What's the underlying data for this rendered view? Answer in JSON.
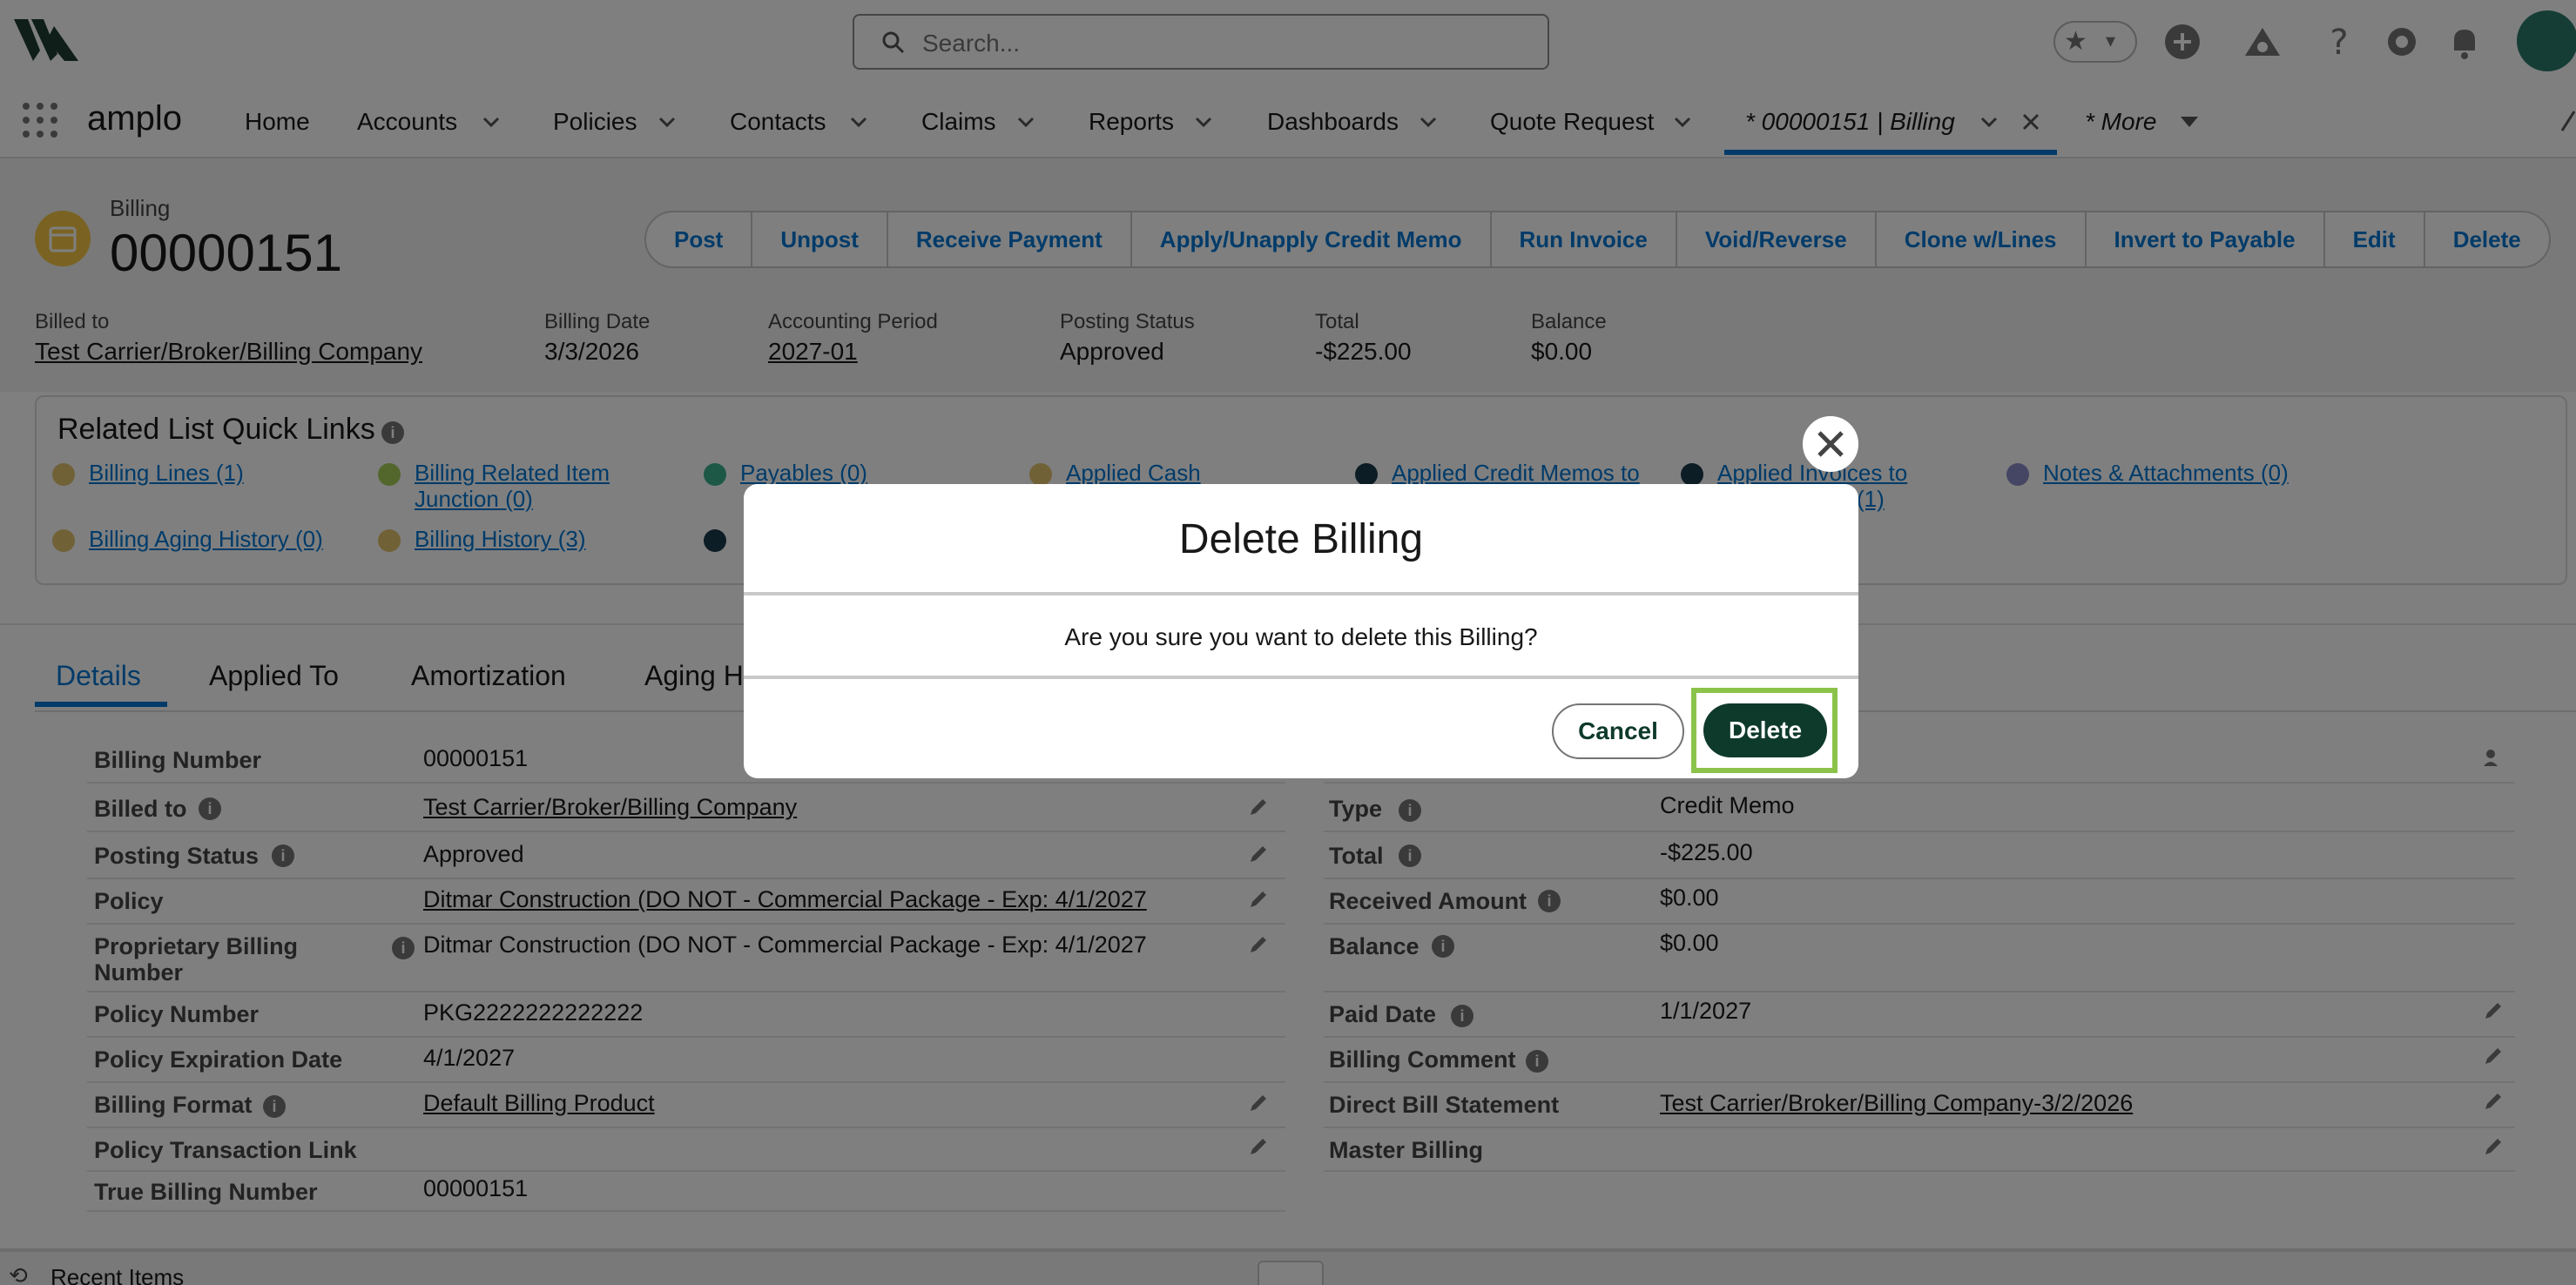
{
  "header": {
    "search_placeholder": "Search..."
  },
  "nav": {
    "app_name": "amplo",
    "items": [
      "Home",
      "Accounts",
      "Policies",
      "Contacts",
      "Claims",
      "Reports",
      "Dashboards",
      "Quote Request"
    ],
    "active_tab": "* 00000151 | Billing",
    "more": "* More"
  },
  "record": {
    "object_label": "Billing",
    "title": "00000151",
    "actions": [
      "Post",
      "Unpost",
      "Receive Payment",
      "Apply/Unapply Credit Memo",
      "Run Invoice",
      "Void/Reverse",
      "Clone w/Lines",
      "Invert to Payable",
      "Edit",
      "Delete"
    ],
    "fields": [
      {
        "label": "Billed to",
        "value": "Test Carrier/Broker/Billing Company"
      },
      {
        "label": "Billing Date",
        "value": "3/3/2026"
      },
      {
        "label": "Accounting Period",
        "value": "2027-01"
      },
      {
        "label": "Posting Status",
        "value": "Approved"
      },
      {
        "label": "Total",
        "value": "-$225.00"
      },
      {
        "label": "Balance",
        "value": "$0.00"
      }
    ]
  },
  "quick_links": {
    "title": "Related List Quick Links",
    "items": [
      "Billing Lines (1)",
      "Billing Related Item Junction (0)",
      "Payables (0)",
      "Applied Cash",
      "Applied Credit Memos to",
      "Applied Invoices to",
      "(1)",
      "Notes & Attachments (0)",
      "Billing Aging History (0)",
      "Billing History (3)"
    ]
  },
  "detail_tabs": [
    "Details",
    "Applied To",
    "Amortization",
    "Aging H"
  ],
  "details_left": [
    {
      "label": "Billing Number",
      "value": "00000151"
    },
    {
      "label": "Billed to",
      "value": "Test Carrier/Broker/Billing Company"
    },
    {
      "label": "Posting Status",
      "value": "Approved"
    },
    {
      "label": "Policy",
      "value": "Ditmar Construction (DO NOT - Commercial Package - Exp: 4/1/2027"
    },
    {
      "label": "Proprietary Billing",
      "label2": "Number",
      "value": "Ditmar Construction (DO NOT - Commercial Package - Exp: 4/1/2027"
    },
    {
      "label": "Policy Number",
      "value": "PKG2222222222222"
    },
    {
      "label": "Policy Expiration Date",
      "value": "4/1/2027"
    },
    {
      "label": "Billing Format",
      "value": "Default Billing Product"
    },
    {
      "label": "Policy Transaction Link",
      "value": ""
    },
    {
      "label": "True Billing Number",
      "value": "00000151"
    }
  ],
  "details_right": [
    {
      "label": "Type",
      "value": "Credit Memo"
    },
    {
      "label": "Total",
      "value": "-$225.00"
    },
    {
      "label": "Received Amount",
      "value": "$0.00"
    },
    {
      "label": "Balance",
      "value": "$0.00"
    },
    {
      "label": "Paid Date",
      "value": "1/1/2027"
    },
    {
      "label": "Billing Comment",
      "value": ""
    },
    {
      "label": "Direct Bill Statement",
      "value": "Test Carrier/Broker/Billing Company-3/2/2026"
    },
    {
      "label": "Master Billing",
      "value": ""
    }
  ],
  "footer": {
    "recent_items": "Recent Items"
  },
  "modal": {
    "title": "Delete Billing",
    "message": "Are you sure you want to delete this Billing?",
    "cancel_label": "Cancel",
    "delete_label": "Delete"
  },
  "colors": {
    "brand_dark": "#0e3a2b",
    "link": "#0176d3",
    "highlight": "#8bc34a"
  }
}
